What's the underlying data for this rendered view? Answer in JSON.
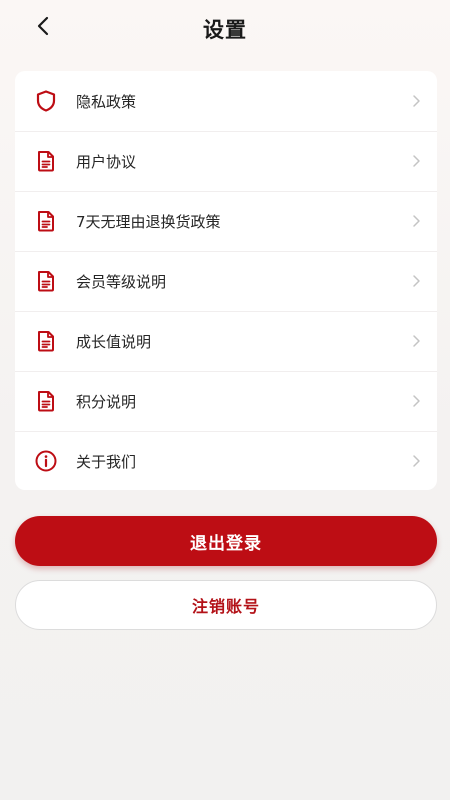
{
  "header": {
    "title": "设置",
    "back_icon": "chevron-left-icon"
  },
  "colors": {
    "accent": "#bd0d14",
    "background": "#f4f2f1",
    "card": "#ffffff"
  },
  "menu": [
    {
      "label": "隐私政策",
      "icon": "shield-icon"
    },
    {
      "label": "用户协议",
      "icon": "document-icon"
    },
    {
      "label": "7天无理由退换货政策",
      "icon": "document-icon"
    },
    {
      "label": "会员等级说明",
      "icon": "document-icon"
    },
    {
      "label": "成长值说明",
      "icon": "document-icon"
    },
    {
      "label": "积分说明",
      "icon": "document-icon"
    },
    {
      "label": "关于我们",
      "icon": "info-icon"
    }
  ],
  "actions": {
    "logout_label": "退出登录",
    "cancel_account_label": "注销账号"
  }
}
